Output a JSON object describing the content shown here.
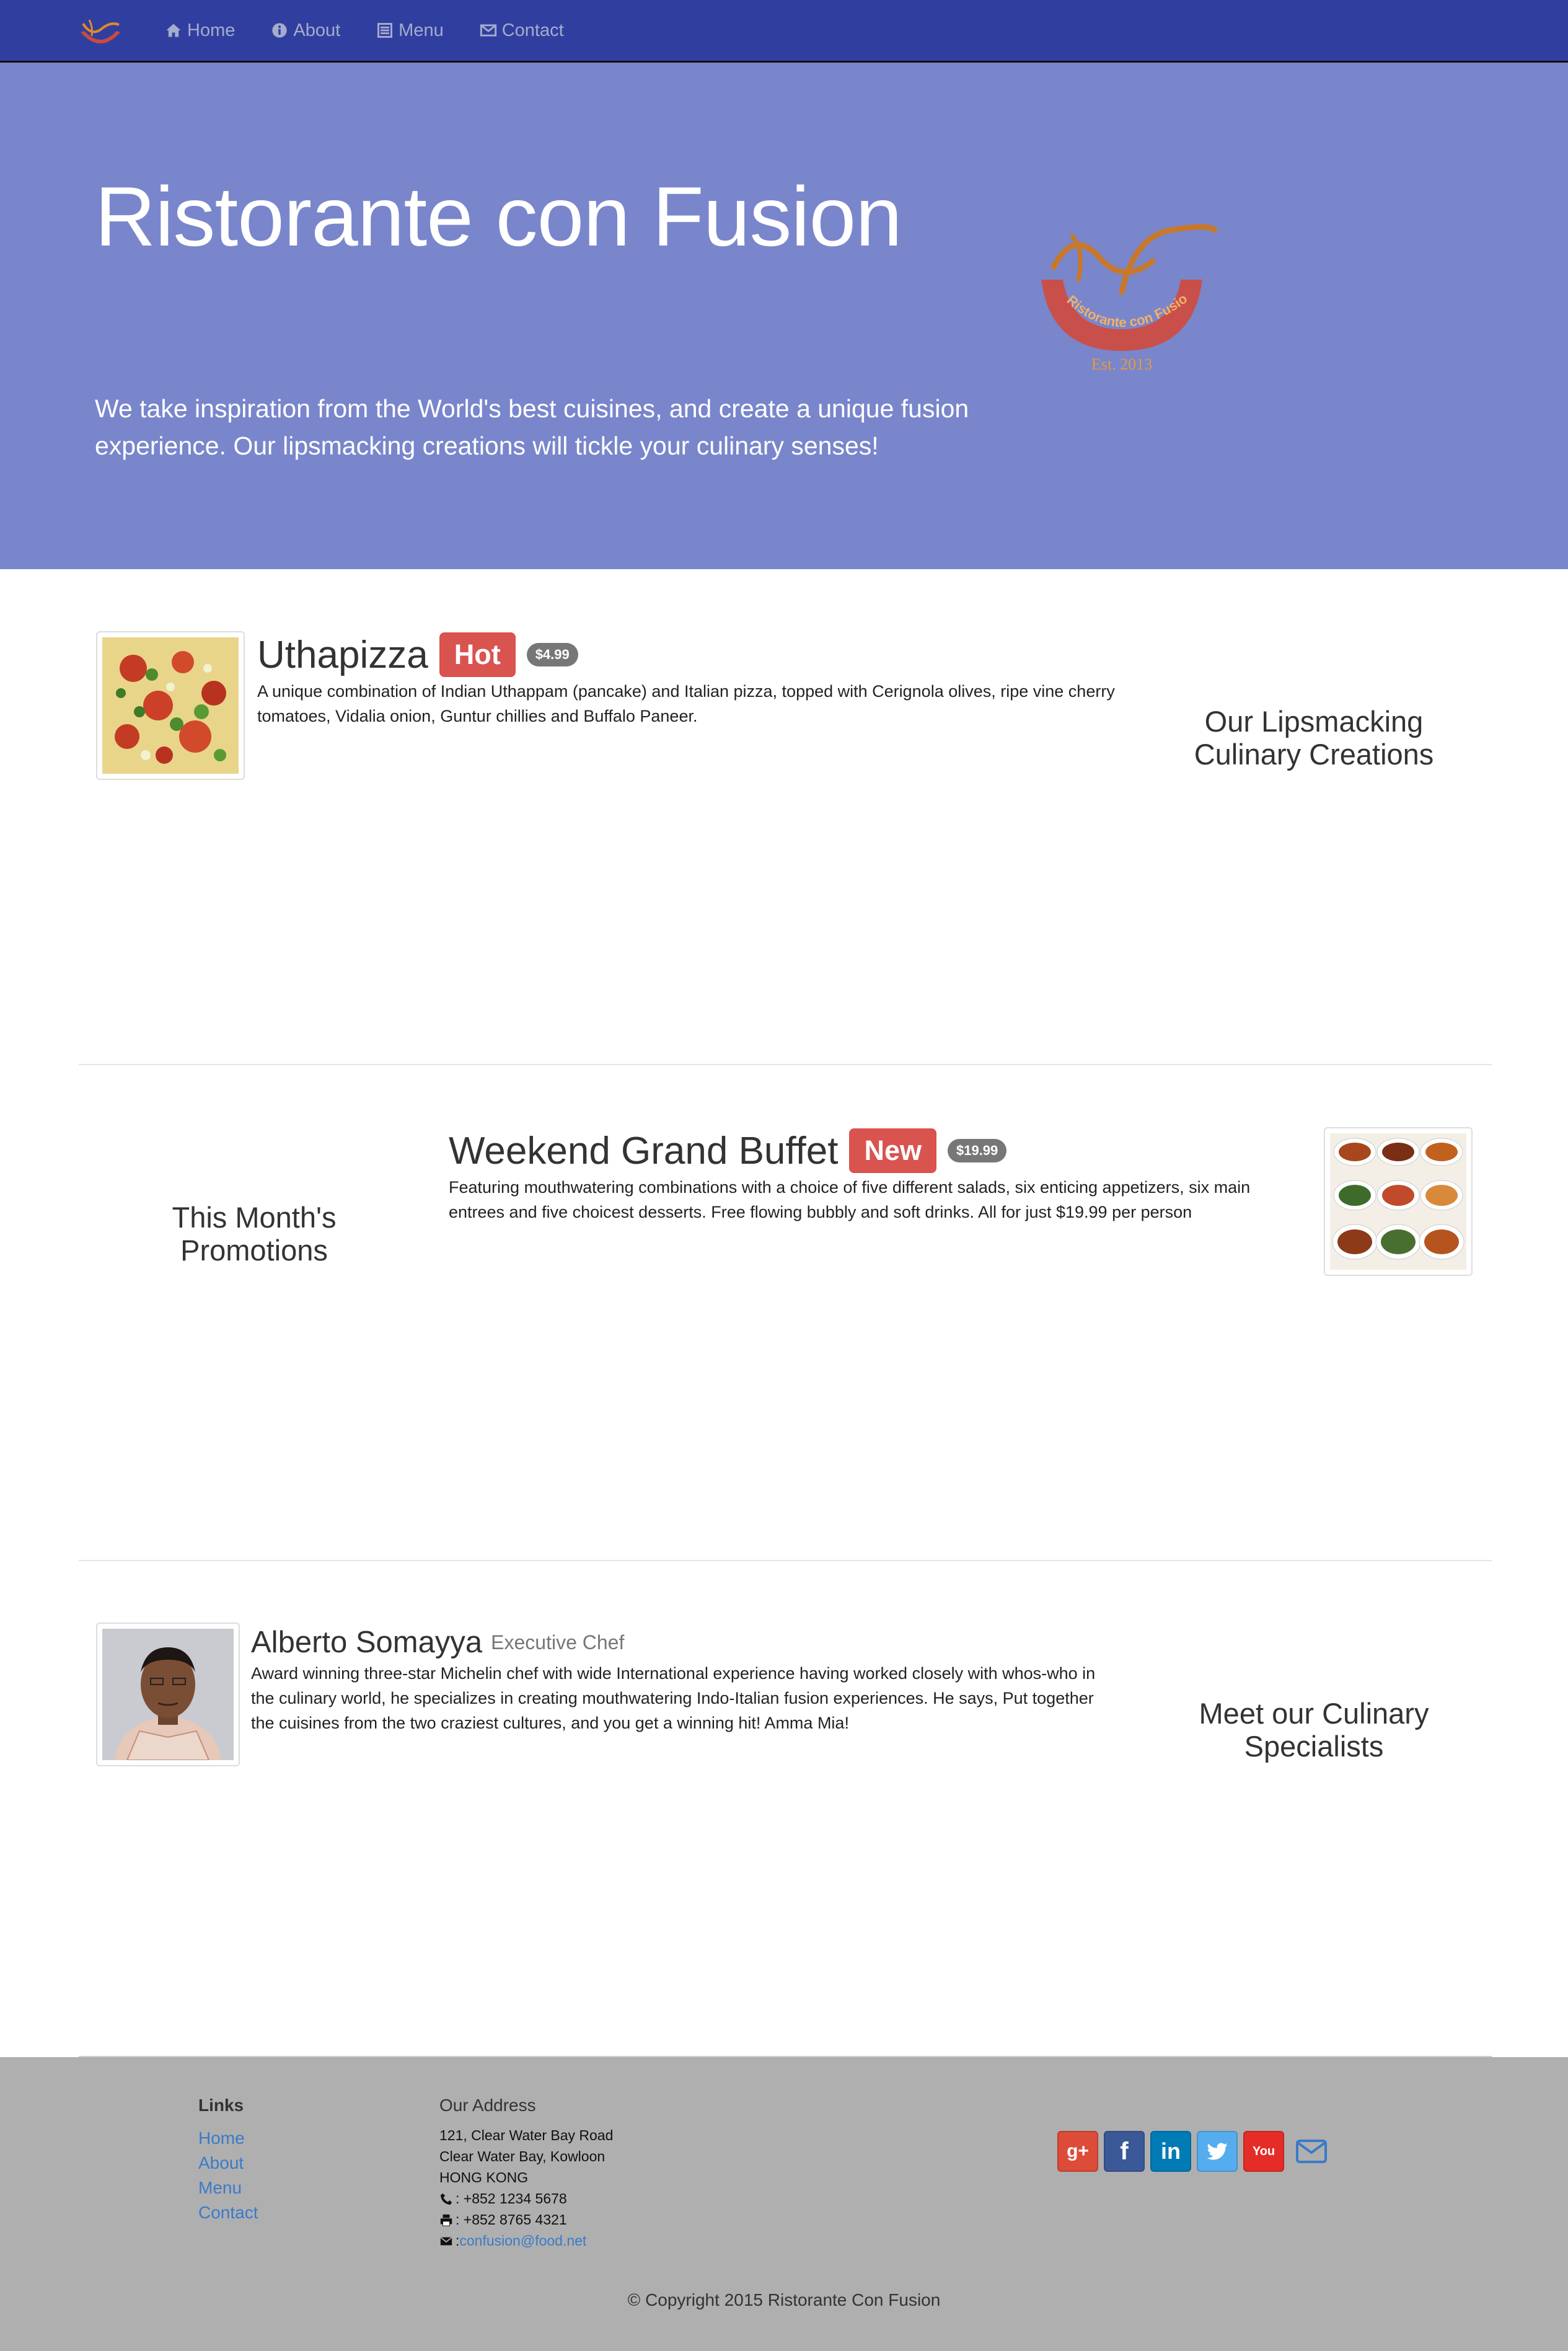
{
  "nav": {
    "brand_logo": "restaurant-logo",
    "items": [
      {
        "label": "Home",
        "icon": "home-icon"
      },
      {
        "label": "About",
        "icon": "info-icon"
      },
      {
        "label": "Menu",
        "icon": "list-icon"
      },
      {
        "label": "Contact",
        "icon": "envelope-icon"
      }
    ]
  },
  "jumbotron": {
    "title": "Ristorante con Fusion",
    "text": "We take inspiration from the World's best cuisines, and create a unique fusion experience. Our lipsmacking creations will tickle your culinary senses!",
    "logo_text": "Ristorante con Fusion",
    "logo_est": "Est. 2013"
  },
  "dish": {
    "name": "Uthapizza",
    "label": "Hot",
    "price": "$4.99",
    "description": "A unique combination of Indian Uthappam (pancake) and Italian pizza, topped with Cerignola olives, ripe vine cherry tomatoes, Vidalia onion, Guntur chillies and Buffalo Paneer.",
    "section_heading": "Our Lipsmacking Culinary Creations"
  },
  "promotion": {
    "name": "Weekend Grand Buffet",
    "label": "New",
    "price": "$19.99",
    "description": "Featuring mouthwatering combinations with a choice of five different salads, six enticing appetizers, six main entrees and five choicest desserts. Free flowing bubbly and soft drinks. All for just $19.99 per person",
    "section_heading": "This Month's Promotions"
  },
  "leader": {
    "name": "Alberto Somayya",
    "role": "Executive Chef",
    "description": "Award winning three-star Michelin chef with wide International experience having worked closely with whos-who in the culinary world, he specializes in creating mouthwatering Indo-Italian fusion experiences. He says, Put together the cuisines from the two craziest cultures, and you get a winning hit! Amma Mia!",
    "section_heading": "Meet our Culinary Specialists"
  },
  "footer": {
    "links_heading": "Links",
    "links": [
      "Home",
      "About",
      "Menu",
      "Contact"
    ],
    "address_heading": "Our Address",
    "address_lines": [
      "121, Clear Water Bay Road",
      "Clear Water Bay, Kowloon",
      "HONG KONG"
    ],
    "phone": ": +852 1234 5678",
    "fax": ": +852 8765 4321",
    "email_prefix": ": ",
    "email": "confusion@food.net",
    "social": [
      {
        "name": "google-plus",
        "glyph": "g+",
        "color": "#DD4B39"
      },
      {
        "name": "facebook",
        "glyph": "f",
        "color": "#3B5998"
      },
      {
        "name": "linkedin",
        "glyph": "in",
        "color": "#007BB6"
      },
      {
        "name": "twitter",
        "glyph": "t",
        "color": "#55ACEE"
      },
      {
        "name": "youtube",
        "glyph": "You",
        "color": "#E52D27"
      }
    ],
    "copyright": "© Copyright 2015 Ristorante Con Fusion"
  }
}
